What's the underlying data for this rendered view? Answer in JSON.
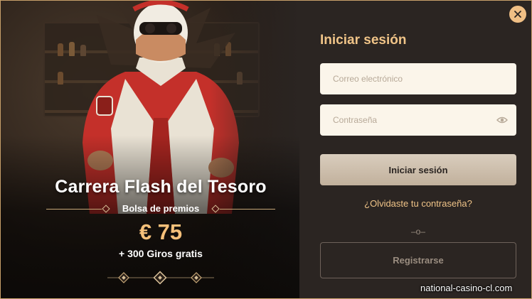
{
  "promo": {
    "title": "Carrera Flash del Tesoro",
    "pool_label": "Bolsa de premios",
    "amount": "€ 75",
    "spins": "+ 300 Giros gratis"
  },
  "login": {
    "title": "Iniciar sesión",
    "email_placeholder": "Correo electrónico",
    "password_placeholder": "Contraseña",
    "submit_label": "Iniciar sesión",
    "forgot_label": "¿Olvidaste tu contraseña?",
    "divider": "–o–",
    "register_label": "Registrarse"
  },
  "watermark": "national-casino-cl.com",
  "icons": {
    "close": "close-icon",
    "password_toggle": "eye-icon"
  },
  "colors": {
    "accent": "#f0c488",
    "amount": "#f5c07a",
    "panel": "#2b2522",
    "field": "#fbf5ea"
  }
}
